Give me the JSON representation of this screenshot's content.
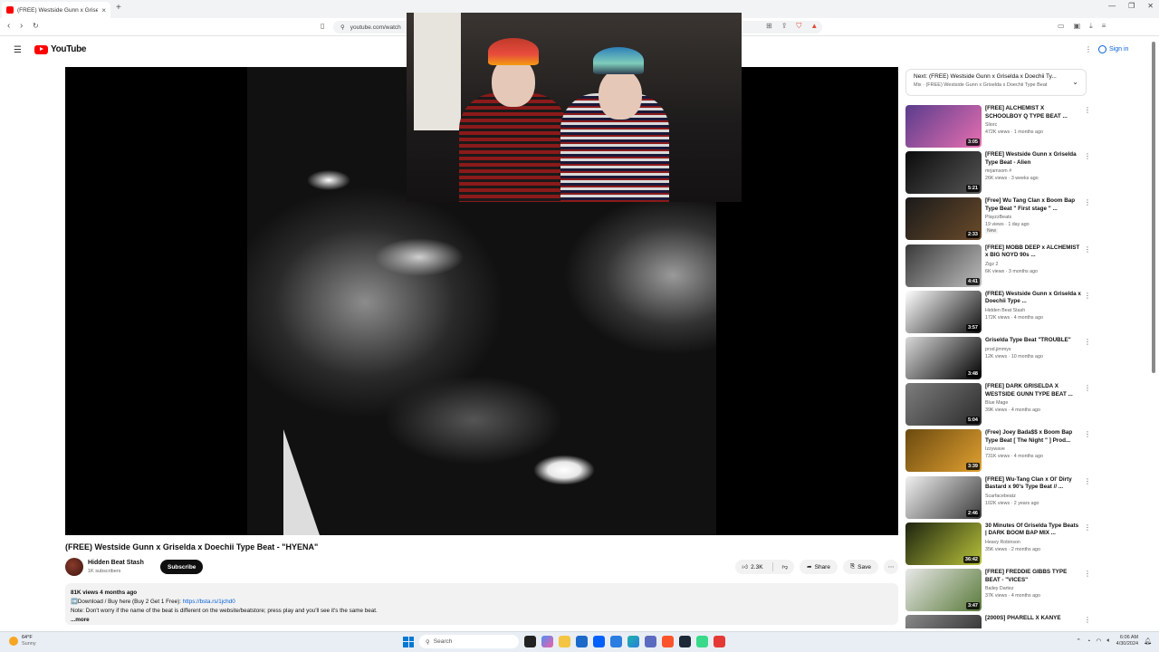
{
  "browser": {
    "tab_title": "(FREE) Westside Gunn x Griselda",
    "url": "youtube.com/watch"
  },
  "youtube": {
    "logo_text": "YouTube",
    "signin_label": "Sign in"
  },
  "video": {
    "title": "(FREE) Westside Gunn x Griselda x Doechii Type Beat - \"HYENA\"",
    "channel_name": "Hidden Beat Stash",
    "channel_subs": "1K subscribers",
    "subscribe_label": "Subscribe",
    "likes": "2.3K",
    "share_label": "Share",
    "save_label": "Save",
    "stats": "81K views  4 months ago",
    "desc_line1_prefix": "➡️Download / Buy here (Buy 2 Get 1 Free): ",
    "desc_link": "https://bsta.rs/1jchd0",
    "desc_line2": "Note: Don't worry if the name of the beat is different on the website/beatstore; press play and you'll see it's the same beat.",
    "more_label": "...more"
  },
  "up_next": {
    "line1": "Next: (FREE) Westside Gunn x Griselda x Doechii Ty...",
    "line2": "Mix · (FREE) Westside Gunn x Griselda x Doechii Type Beat"
  },
  "recommendations": [
    {
      "title": "[FREE] ALCHEMIST X SCHOOLBOY Q TYPE BEAT ...",
      "channel": "Sliorc",
      "meta": "472K views · 1 months ago",
      "duration": "3:05",
      "thumb_a": "#5a3c8c",
      "thumb_b": "#e76fb0"
    },
    {
      "title": "[FREE] Westside Gunn x Griselda Type Beat - Alien",
      "channel": "mrjamsom #",
      "meta": "26K views · 3 weeks ago",
      "duration": "5:21",
      "thumb_a": "#0b0b0b",
      "thumb_b": "#555"
    },
    {
      "title": "[Free] Wu Tang Clan x Boom Bap Type Beat \" First stage \" ...",
      "channel": "PlayzzBeats",
      "meta": "19 views · 1 day ago",
      "badge": "New",
      "duration": "2:33",
      "thumb_a": "#1a1a1a",
      "thumb_b": "#6a4b2b"
    },
    {
      "title": "[FREE] MOBB DEEP x ALCHEMIST x BIG NOYD 90s ...",
      "channel": "Zigz 2",
      "meta": "6K views · 3 months ago",
      "duration": "4:41",
      "thumb_a": "#3a3a3a",
      "thumb_b": "#bdbdbd"
    },
    {
      "title": "(FREE) Westside Gunn x Griselda x Doechii Type ...",
      "channel": "Hidden Beat Stash",
      "meta": "172K views · 4 months ago",
      "duration": "3:57",
      "thumb_a": "#ffffff",
      "thumb_b": "#111"
    },
    {
      "title": "Griselda Type Beat \"TROUBLE\"",
      "channel": "prod.jimmys",
      "meta": "12K views · 10 months ago",
      "duration": "3:48",
      "thumb_a": "#d9d9d9",
      "thumb_b": "#000"
    },
    {
      "title": "[FREE] DARK GRISELDA X WESTSIDE GUNN TYPE BEAT ...",
      "channel": "Blue Mage",
      "meta": "39K views · 4 months ago",
      "duration": "5:04",
      "thumb_a": "#7d7d7d",
      "thumb_b": "#2b2b2b"
    },
    {
      "title": "(Free) Joey Bada$$ x Boom Bap Type Beat [ The Night \" ] Prod...",
      "channel": "Izzywave",
      "meta": "731K views · 4 months ago",
      "duration": "3:39",
      "thumb_a": "#6b4a10",
      "thumb_b": "#e0a030"
    },
    {
      "title": "[FREE] Wu-Tang Clan x Ol' Dirty Bastard x 90's Type Beat // ...",
      "channel": "Scarfacebeatz",
      "meta": "102K views · 2 years ago",
      "duration": "2:46",
      "thumb_a": "#f1f1f1",
      "thumb_b": "#3a3a3a"
    },
    {
      "title": "30 Minutes Of Griselda Type Beats | DARK BOOM BAP MIX ...",
      "channel": "Heavy Robinson",
      "meta": "35K views · 2 months ago",
      "duration": "36:42",
      "thumb_a": "#1d2410",
      "thumb_b": "#b7c23a"
    },
    {
      "title": "[FREE] FREDDIE GIBBS TYPE BEAT - \"VICES\"",
      "channel": "Bailey Dartez",
      "meta": "37K views · 4 months ago",
      "duration": "3:47",
      "thumb_a": "#e8e8e8",
      "thumb_b": "#5a7a3a"
    },
    {
      "title": "[2000S] PHARELL X KANYE",
      "channel": "",
      "meta": "",
      "duration": "",
      "thumb_a": "#888",
      "thumb_b": "#222"
    }
  ],
  "taskbar": {
    "weather_temp": "64°F",
    "weather_cond": "Sunny",
    "search_label": "Search",
    "time": "6:06 AM",
    "date": "4/30/2024"
  }
}
